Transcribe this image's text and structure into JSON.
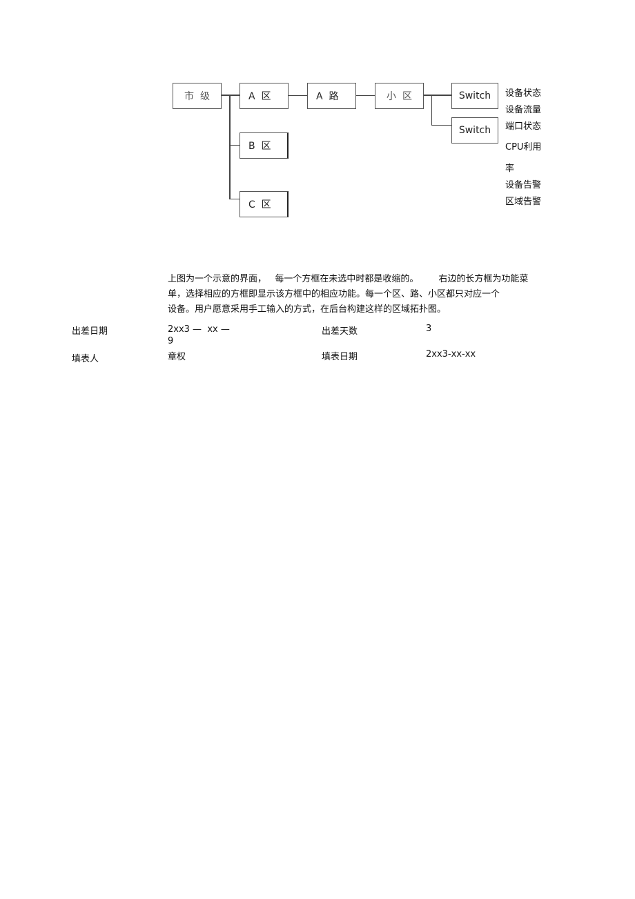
{
  "diagram": {
    "nodes": {
      "city": "市  级",
      "area_a": "A  区",
      "road_a": "A  路",
      "district": "小  区",
      "switch_1": "Switch",
      "switch_2": "Switch",
      "area_b": "B  区",
      "area_c": "C  区"
    },
    "function_menu": [
      "设备状态",
      "设备流量",
      "端口状态",
      "CPU利用",
      "率",
      "设备告警",
      "区域告警"
    ]
  },
  "description": {
    "lines": [
      "上图为一个示意的界面，   每一个方框在未选中时都是收缩的。       右边的长方框为功能菜",
      "单，选择相应的方框即显示该方框中的相应功能。每一个区、路、小区都只对应一个",
      "设备。用户愿意采用手工输入的方式，在后台构建这样的区域拓扑图。"
    ]
  },
  "form": {
    "trip_date_label": "出差日期",
    "trip_date_value_line1": "2xx3 —  xx —",
    "trip_date_value_line2": "9",
    "trip_days_label": "出差天数",
    "trip_days_value": "3",
    "filler_label": "填表人",
    "filler_value": "章权",
    "fill_date_label": "填表日期",
    "fill_date_value": "2xx3-xx-xx"
  }
}
